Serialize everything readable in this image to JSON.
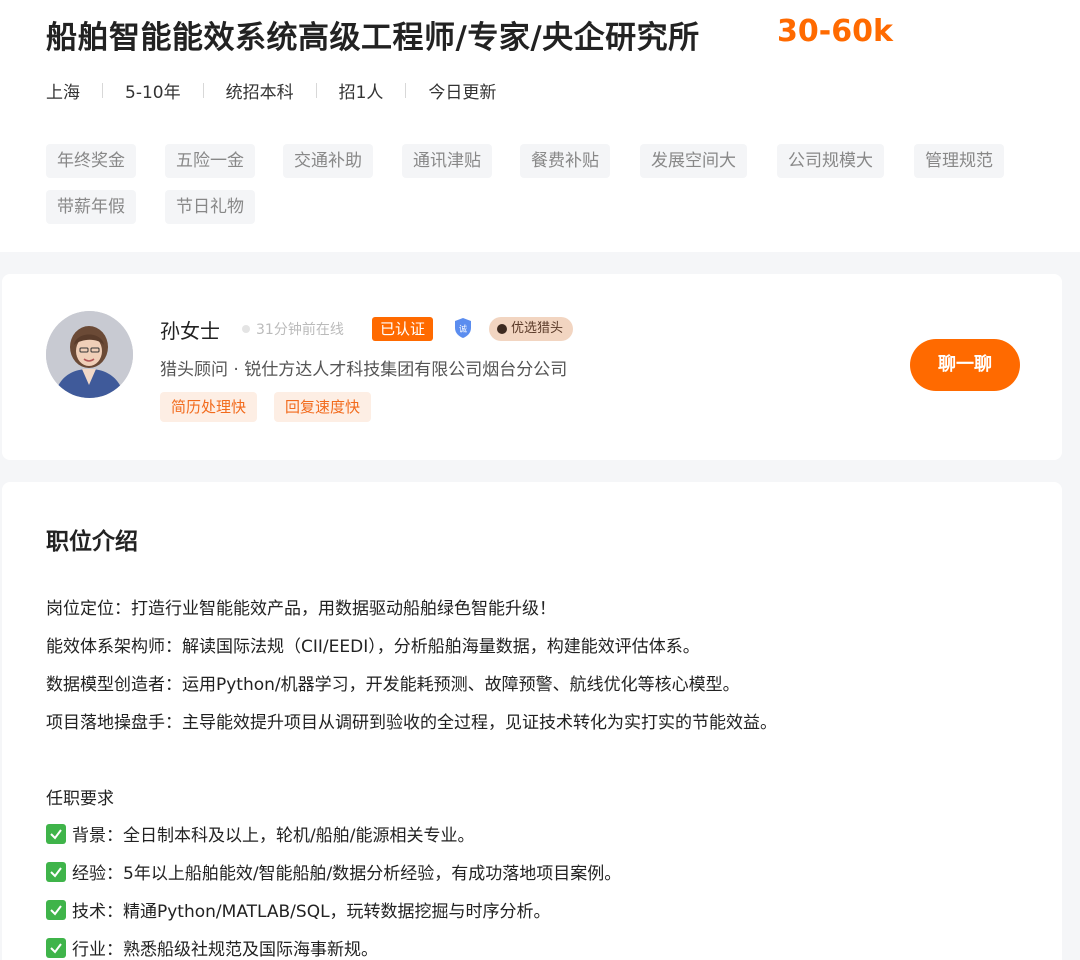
{
  "job": {
    "title": "船舶智能能效系统高级工程师/专家/央企研究所",
    "salary": "30-60k",
    "meta": [
      "上海",
      "5-10年",
      "统招本科",
      "招1人",
      "今日更新"
    ],
    "benefits": [
      "年终奖金",
      "五险一金",
      "交通补助",
      "通讯津贴",
      "餐费补贴",
      "发展空间大",
      "公司规模大",
      "管理规范",
      "带薪年假",
      "节日礼物"
    ]
  },
  "recruiter": {
    "name": "孙女士",
    "online_status": "31分钟前在线",
    "verified_label": "已认证",
    "shield_icon": "shield-icon",
    "premium_label": "优选猎头",
    "subtitle": "猎头顾问 · 锐仕方达人才科技集团有限公司烟台分公司",
    "tags": [
      "简历处理快",
      "回复速度快"
    ],
    "chat_button": "聊一聊"
  },
  "description": {
    "section_title": "职位介绍",
    "lines": [
      "岗位定位：打造行业智能能效产品，用数据驱动船舶绿色智能升级！",
      "能效体系架构师：解读国际法规（CII/EEDI），分析船舶海量数据，构建能效评估体系。",
      "数据模型创造者：运用Python/机器学习，开发能耗预测、故障预警、航线优化等核心模型。",
      "项目落地操盘手：主导能效提升项目从调研到验收的全过程，见证技术转化为实打实的节能效益。"
    ],
    "requirements_title": "任职要求",
    "requirements": [
      "背景：全日制本科及以上，轮机/船舶/能源相关专业。",
      "经验：5年以上船舶能效/智能船舶/数据分析经验，有成功落地项目案例。",
      "技术：精通Python/MATLAB/SQL，玩转数据挖掘与时序分析。",
      "行业：熟悉船级社规范及国际海事新规。"
    ]
  },
  "colors": {
    "accent": "#ff6a00",
    "check_green": "#3fb44a",
    "tag_bg": "#f4f5f7",
    "recruiter_tag_text": "#f26b1d"
  }
}
